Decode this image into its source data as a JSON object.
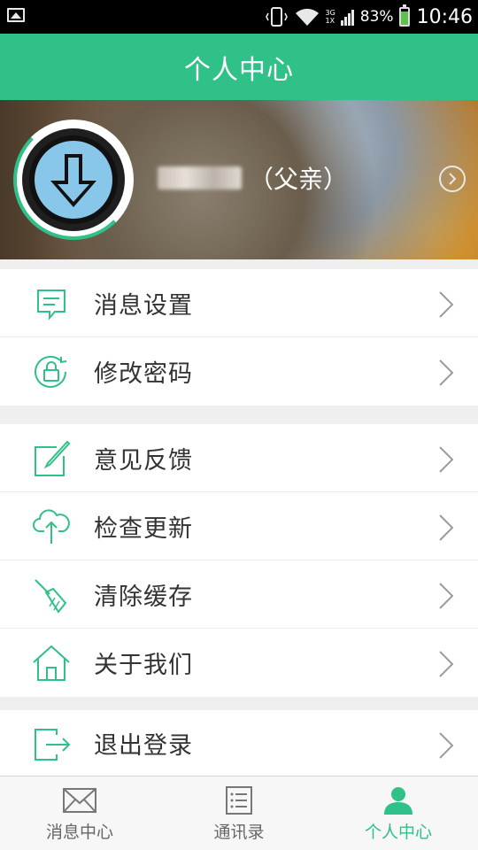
{
  "status_bar": {
    "battery_pct": "83%",
    "battery_level": 0.83,
    "network_top": "3G",
    "network_bottom": "1X",
    "time": "10:46",
    "icons": [
      "picture-icon",
      "vibrate-icon",
      "wifi-icon",
      "signal-icon",
      "battery-icon"
    ]
  },
  "header": {
    "title": "个人中心"
  },
  "profile": {
    "relation": "（父亲）",
    "avatar_icon": "download-arrow-icon"
  },
  "menu_groups": [
    {
      "items": [
        {
          "label": "消息设置",
          "icon": "message-icon"
        },
        {
          "label": "修改密码",
          "icon": "lock-refresh-icon"
        }
      ]
    },
    {
      "items": [
        {
          "label": "意见反馈",
          "icon": "edit-icon"
        },
        {
          "label": "检查更新",
          "icon": "cloud-upload-icon"
        },
        {
          "label": "清除缓存",
          "icon": "broom-icon"
        },
        {
          "label": "关于我们",
          "icon": "home-icon"
        }
      ]
    },
    {
      "items": [
        {
          "label": "退出登录",
          "icon": "logout-icon"
        }
      ]
    }
  ],
  "tabs": [
    {
      "label": "消息中心",
      "icon": "mail-icon",
      "active": false
    },
    {
      "label": "通讯录",
      "icon": "contacts-list-icon",
      "active": false
    },
    {
      "label": "个人中心",
      "icon": "person-icon",
      "active": true
    }
  ],
  "colors": {
    "accent": "#2fc187",
    "text": "#333333",
    "icon_stroke": "#2fc187"
  }
}
